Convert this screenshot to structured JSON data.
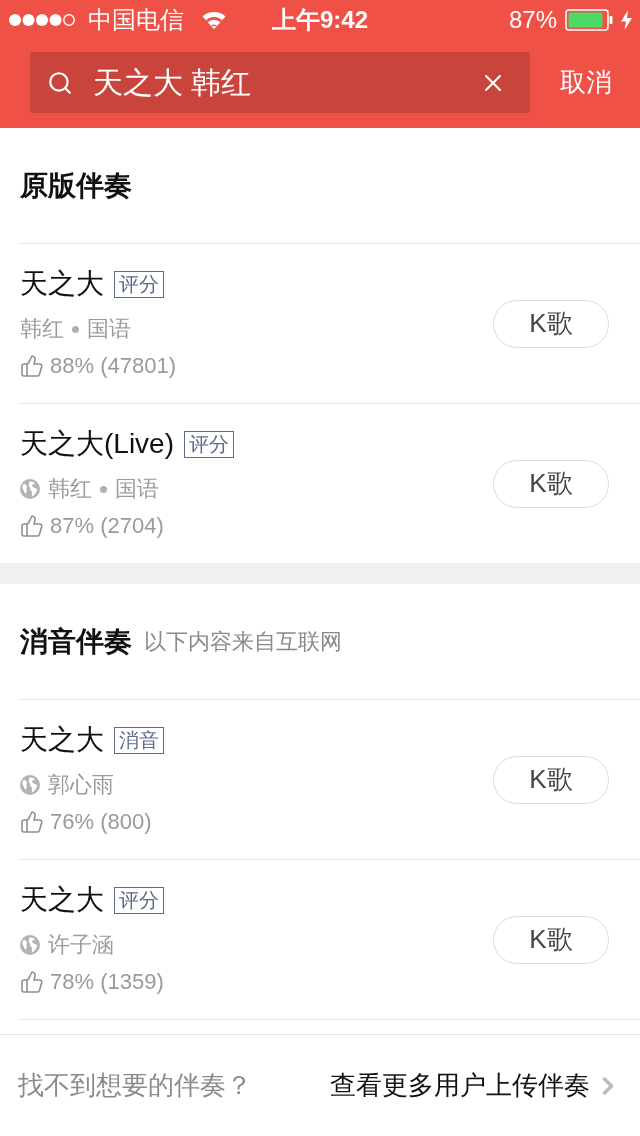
{
  "status_bar": {
    "carrier": "中国电信",
    "time": "上午9:42",
    "battery": "87%"
  },
  "search": {
    "value": "天之大 韩红",
    "cancel": "取消"
  },
  "sections": [
    {
      "title": "原版伴奏",
      "items": [
        {
          "title": "天之大",
          "badge": "评分",
          "web_source": false,
          "meta": [
            "韩红",
            "国语"
          ],
          "rating": "88% (47801)",
          "button": "K歌"
        },
        {
          "title": "天之大(Live)",
          "badge": "评分",
          "web_source": true,
          "meta": [
            "韩红",
            "国语"
          ],
          "rating": "87% (2704)",
          "button": "K歌"
        }
      ]
    },
    {
      "title": "消音伴奏",
      "subtitle": "以下内容来自互联网",
      "items": [
        {
          "title": "天之大",
          "badge": "消音",
          "web_source": true,
          "meta": [
            "郭心雨"
          ],
          "rating": "76% (800)",
          "button": "K歌"
        },
        {
          "title": "天之大",
          "badge": "评分",
          "web_source": true,
          "meta": [
            "许子涵"
          ],
          "rating": "78% (1359)",
          "button": "K歌"
        }
      ]
    }
  ],
  "footer": {
    "hint": "找不到想要的伴奏？",
    "link": "查看更多用户上传伴奏"
  }
}
